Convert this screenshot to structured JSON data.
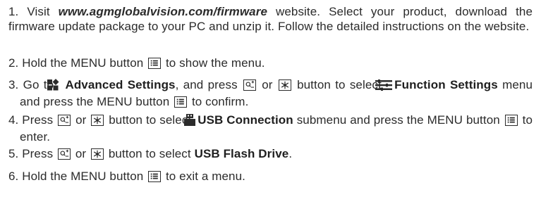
{
  "steps": {
    "s1": {
      "num": "1.",
      "t1": "Visit",
      "url": "www.agmglobalvision.com/firmware",
      "t2": "website. Select your product, download the firmware update package to your PC and unzip it. Follow the detailed instructions on the website."
    },
    "s2": {
      "num": "2.",
      "t1": "Hold the MENU button",
      "t2": "to show the menu."
    },
    "s3": {
      "num": "3.",
      "t1": "Go to",
      "b1": "Advanced Settings",
      "t2": ", and press",
      "t3": "or",
      "t4": "button to select",
      "b2": "Function Settings",
      "t5": "menu and press the MENU button",
      "t6": "to confirm."
    },
    "s4": {
      "num": "4.",
      "t1": "Press",
      "t2": "or",
      "t3": "button to select",
      "b1": "USB Connection",
      "t4": "submenu and press the MENU button",
      "t5": "to enter."
    },
    "s5": {
      "num": "5.",
      "t1": "Press",
      "t2": "or",
      "t3": "button to select",
      "b1": "USB Flash Drive",
      "t4": "."
    },
    "s6": {
      "num": "6.",
      "t1": "Hold the MENU button",
      "t2": "to exit a menu."
    }
  },
  "icons": {
    "menu": "menu-icon",
    "palette": "palette-icon",
    "star": "star-icon",
    "advanced": "advanced-settings-icon",
    "function": "function-settings-icon",
    "usb": "usb-connection-icon"
  }
}
